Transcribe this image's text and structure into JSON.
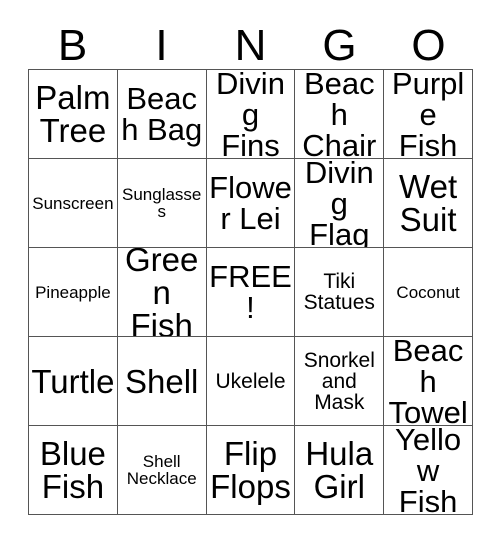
{
  "header": {
    "letters": [
      "B",
      "I",
      "N",
      "G",
      "O"
    ]
  },
  "grid": {
    "rows": [
      [
        {
          "label": "Palm Tree",
          "size": "fs-xl"
        },
        {
          "label": "Beach Bag",
          "size": "fs-lg"
        },
        {
          "label": "Diving Fins",
          "size": "fs-lg"
        },
        {
          "label": "Beach Chair",
          "size": "fs-lg"
        },
        {
          "label": "Purple Fish",
          "size": "fs-lg"
        }
      ],
      [
        {
          "label": "Sunscreen",
          "size": "fs-xs"
        },
        {
          "label": "Sunglasses",
          "size": "fs-xs"
        },
        {
          "label": "Flower Lei",
          "size": "fs-lg"
        },
        {
          "label": "Diving Flag",
          "size": "fs-lg"
        },
        {
          "label": "Wet Suit",
          "size": "fs-xl"
        }
      ],
      [
        {
          "label": "Pineapple",
          "size": "fs-xs"
        },
        {
          "label": "Green Fish",
          "size": "fs-xl"
        },
        {
          "label": "FREE!",
          "size": "fs-lg"
        },
        {
          "label": "Tiki Statues",
          "size": "fs-sm"
        },
        {
          "label": "Coconut",
          "size": "fs-xs"
        }
      ],
      [
        {
          "label": "Turtle",
          "size": "fs-xl"
        },
        {
          "label": "Shell",
          "size": "fs-xl"
        },
        {
          "label": "Ukelele",
          "size": "fs-sm"
        },
        {
          "label": "Snorkel and Mask",
          "size": "fs-sm"
        },
        {
          "label": "Beach Towel",
          "size": "fs-lg"
        }
      ],
      [
        {
          "label": "Blue Fish",
          "size": "fs-xl"
        },
        {
          "label": "Shell Necklace",
          "size": "fs-xs"
        },
        {
          "label": "Flip Flops",
          "size": "fs-xl"
        },
        {
          "label": "Hula Girl",
          "size": "fs-xl"
        },
        {
          "label": "Yellow Fish",
          "size": "fs-lg"
        }
      ]
    ]
  }
}
